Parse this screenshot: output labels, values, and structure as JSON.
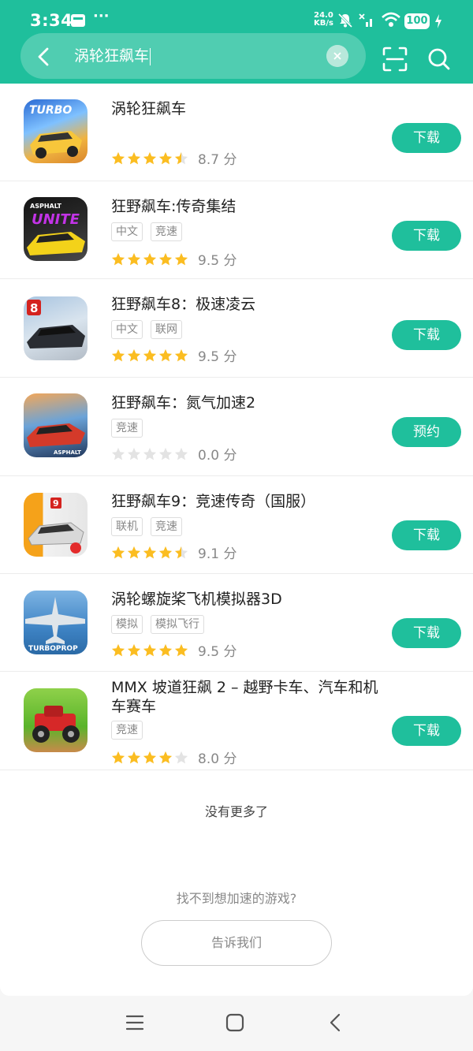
{
  "status_bar": {
    "time": "3:34",
    "dots": "···",
    "net_speed_value": "24.0",
    "net_speed_unit": "KB/s",
    "battery": "100"
  },
  "search": {
    "query": "涡轮狂飙车"
  },
  "results": [
    {
      "title": "涡轮狂飙车",
      "tags": [],
      "rating": 4.5,
      "score": "8.7 分",
      "button": "下载",
      "icon": "turbo-racing-icon"
    },
    {
      "title": "狂野飙车:传奇集结",
      "tags": [
        "中文",
        "竞速"
      ],
      "rating": 5,
      "score": "9.5 分",
      "button": "下载",
      "icon": "asphalt-unite-icon"
    },
    {
      "title": "狂野飙车8：极速凌云",
      "tags": [
        "中文",
        "联网"
      ],
      "rating": 5,
      "score": "9.5 分",
      "button": "下载",
      "icon": "asphalt-8-icon"
    },
    {
      "title": "狂野飙车：氮气加速2",
      "tags": [
        "竞速"
      ],
      "rating": 0,
      "score": "0.0 分",
      "button": "预约",
      "icon": "asphalt-nitro-2-icon"
    },
    {
      "title": "狂野飙车9：竞速传奇（国服）",
      "tags": [
        "联机",
        "竞速"
      ],
      "rating": 4.5,
      "score": "9.1 分",
      "button": "下载",
      "icon": "asphalt-9-icon"
    },
    {
      "title": "涡轮螺旋桨飞机模拟器3D",
      "tags": [
        "模拟",
        "模拟飞行"
      ],
      "rating": 5,
      "score": "9.5 分",
      "button": "下载",
      "icon": "turboprop-icon"
    },
    {
      "title": "MMX 坡道狂飙 2 – 越野卡车、汽车和机车赛车",
      "tags": [
        "竞速"
      ],
      "rating": 4,
      "score": "8.0 分",
      "button": "下载",
      "icon": "mmx-hill-dash-icon"
    }
  ],
  "footer": {
    "no_more": "没有更多了",
    "cant_find": "找不到想加速的游戏?",
    "tell_us": "告诉我们"
  },
  "colors": {
    "accent": "#1fbf9c",
    "star": "#fbbd21",
    "star_empty": "#e3e3e3"
  }
}
